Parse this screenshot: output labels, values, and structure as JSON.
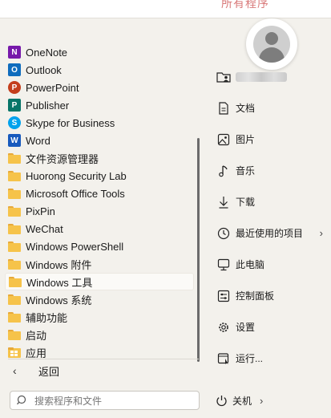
{
  "peek_text": "所有程序",
  "programs": [
    {
      "label": "OneNote",
      "icon": "onenote-icon",
      "glyph": "N",
      "color": "#7719aa"
    },
    {
      "label": "Outlook",
      "icon": "outlook-icon",
      "glyph": "O",
      "color": "#0f6cbd"
    },
    {
      "label": "PowerPoint",
      "icon": "powerpoint-icon",
      "glyph": "P",
      "color": "#c43e1c"
    },
    {
      "label": "Publisher",
      "icon": "publisher-icon",
      "glyph": "P",
      "color": "#077568"
    },
    {
      "label": "Skype for Business",
      "icon": "skype-icon",
      "glyph": "S",
      "color": "#00a2ed"
    },
    {
      "label": "Word",
      "icon": "word-icon",
      "glyph": "W",
      "color": "#185abd"
    },
    {
      "label": "文件资源管理器",
      "icon": "folder-icon"
    },
    {
      "label": "Huorong Security Lab",
      "icon": "folder-icon"
    },
    {
      "label": "Microsoft Office Tools",
      "icon": "folder-icon"
    },
    {
      "label": "PixPin",
      "icon": "folder-icon"
    },
    {
      "label": "WeChat",
      "icon": "folder-icon"
    },
    {
      "label": "Windows PowerShell",
      "icon": "folder-icon"
    },
    {
      "label": "Windows 附件",
      "icon": "folder-icon"
    },
    {
      "label": "Windows 工具",
      "icon": "folder-icon"
    },
    {
      "label": "Windows 系统",
      "icon": "folder-icon"
    },
    {
      "label": "辅助功能",
      "icon": "folder-icon"
    },
    {
      "label": "启动",
      "icon": "folder-icon"
    },
    {
      "label": "应用",
      "icon": "apps-folder-icon"
    }
  ],
  "back_label": "返回",
  "search_placeholder": "搜索程序和文件",
  "right_items": [
    {
      "label": "文档",
      "icon": "document-icon"
    },
    {
      "label": "图片",
      "icon": "picture-icon"
    },
    {
      "label": "音乐",
      "icon": "music-icon"
    },
    {
      "label": "下载",
      "icon": "download-icon"
    },
    {
      "label": "最近使用的项目",
      "icon": "clock-icon",
      "arrow": true
    },
    {
      "label": "此电脑",
      "icon": "computer-icon"
    },
    {
      "label": "控制面板",
      "icon": "control-panel-icon"
    },
    {
      "label": "设置",
      "icon": "gear-icon"
    },
    {
      "label": "运行...",
      "icon": "run-icon"
    }
  ],
  "power_label": "关机"
}
